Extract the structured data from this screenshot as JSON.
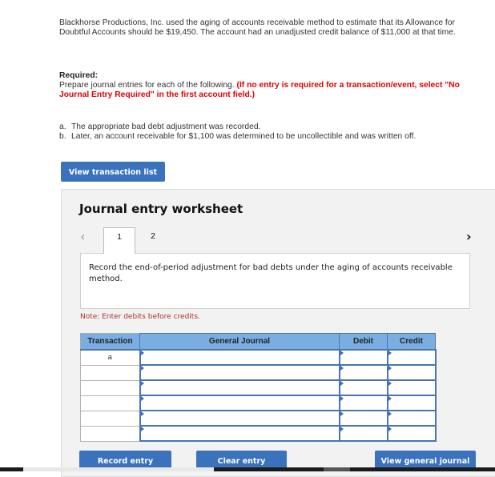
{
  "intro": "Blackhorse Productions, Inc. used the aging of accounts receivable method to estimate that its Allowance for Doubtful Accounts should be $19,450. The account had an unadjusted credit balance of $11,000 at that time.",
  "required": {
    "label": "Required:",
    "text": "Prepare journal entries for each of the following. ",
    "instruction": "(If no entry is required for a transaction/event, select \"No Journal Entry Required\" in the first account field.)"
  },
  "items": [
    {
      "marker": "a.",
      "text": "The appropriate bad debt adjustment was recorded."
    },
    {
      "marker": "b.",
      "text": "Later, an account receivable for $1,100 was determined to be uncollectible and was written off."
    }
  ],
  "buttons": {
    "view_transaction_list": "View transaction list",
    "record_entry": "Record entry",
    "clear_entry": "Clear entry",
    "view_general_journal": "View general journal"
  },
  "worksheet": {
    "title": "Journal entry worksheet",
    "prev_icon": "‹",
    "next_icon": "›",
    "tabs": [
      {
        "label": "1",
        "active": true
      },
      {
        "label": "2",
        "active": false
      }
    ],
    "description": "Record the end-of-period adjustment for bad debts under the aging of accounts receivable method.",
    "note": "Note: Enter debits before credits."
  },
  "table": {
    "headers": [
      "Transaction",
      "General Journal",
      "Debit",
      "Credit"
    ],
    "rows": [
      {
        "transaction": "a",
        "account": "",
        "debit": "",
        "credit": ""
      },
      {
        "transaction": "",
        "account": "",
        "debit": "",
        "credit": ""
      },
      {
        "transaction": "",
        "account": "",
        "debit": "",
        "credit": ""
      },
      {
        "transaction": "",
        "account": "",
        "debit": "",
        "credit": ""
      },
      {
        "transaction": "",
        "account": "",
        "debit": "",
        "credit": ""
      },
      {
        "transaction": "",
        "account": "",
        "debit": "",
        "credit": ""
      }
    ]
  },
  "colors": {
    "button_blue": "#3a73bb",
    "header_blue": "#7aaee3",
    "instruction_red": "#e00000",
    "note_red": "#b03030"
  }
}
